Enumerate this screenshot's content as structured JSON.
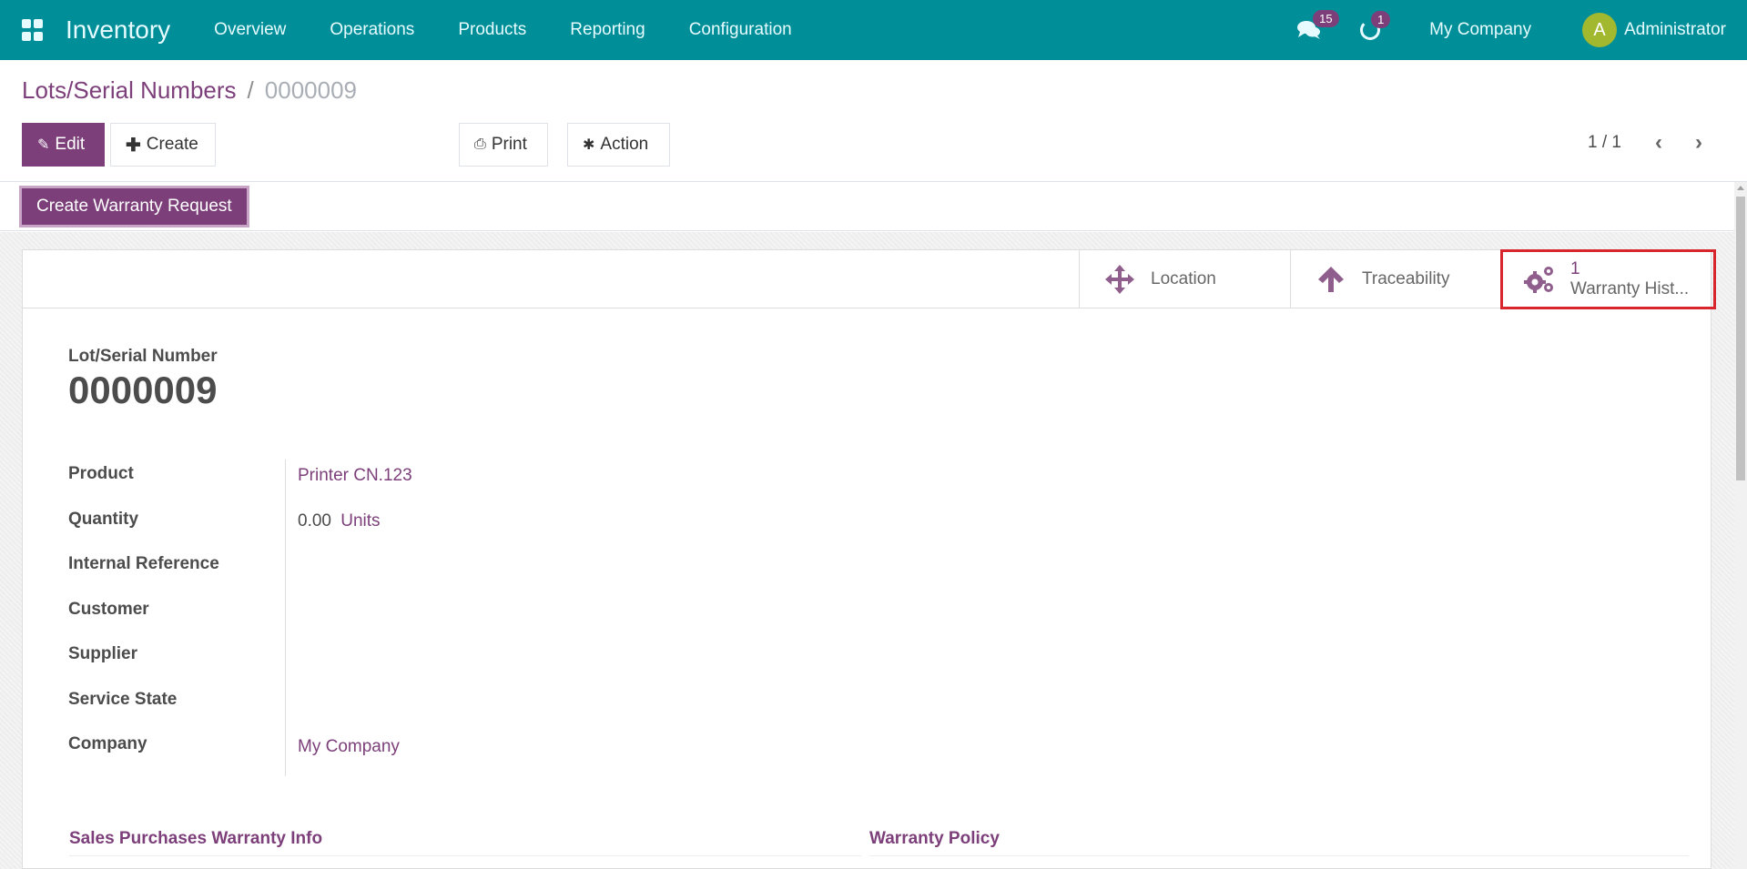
{
  "navbar": {
    "app_name": "Inventory",
    "menu": [
      "Overview",
      "Operations",
      "Products",
      "Reporting",
      "Configuration"
    ],
    "messages_count": "15",
    "activities_count": "1",
    "company": "My Company",
    "avatar_initial": "A",
    "user": "Administrator"
  },
  "breadcrumb": {
    "parent": "Lots/Serial Numbers",
    "separator": "/",
    "current": "0000009"
  },
  "toolbar": {
    "edit_label": "Edit",
    "create_label": "Create",
    "print_label": "Print",
    "action_label": "Action",
    "pager": "1 / 1"
  },
  "statusbar": {
    "create_warranty_label": "Create Warranty Request"
  },
  "smart_buttons": {
    "location_label": "Location",
    "traceability_label": "Traceability",
    "warranty_count": "1",
    "warranty_label": "Warranty Hist..."
  },
  "form": {
    "title_label": "Lot/Serial Number",
    "title_value": "0000009",
    "fields": [
      {
        "label": "Product",
        "value": "Printer CN.123"
      },
      {
        "label": "Quantity",
        "value": "0.00",
        "unit": "Units"
      },
      {
        "label": "Internal Reference",
        "value": ""
      },
      {
        "label": "Customer",
        "value": ""
      },
      {
        "label": "Supplier",
        "value": ""
      },
      {
        "label": "Service State",
        "value": ""
      },
      {
        "label": "Company",
        "value": "My Company"
      }
    ],
    "sections": [
      "Sales Purchases Warranty Info",
      "Warranty Policy"
    ]
  },
  "colors": {
    "navbar": "#008f99",
    "primary": "#7c3f7a",
    "highlight": "#d9262c",
    "avatar": "#a2b82f"
  }
}
